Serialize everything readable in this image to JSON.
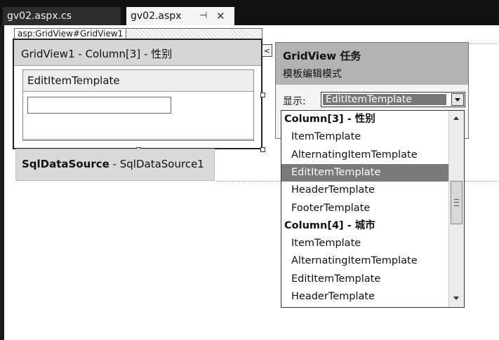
{
  "tabs": [
    {
      "label": "gv02.aspx.cs"
    },
    {
      "label": "gv02.aspx"
    }
  ],
  "icons": {
    "pin": "pin-icon",
    "close": "close-icon"
  },
  "designer": {
    "tag_label": "asp:GridView#GridView1",
    "column_title": "GridView1 - Column[3] - 性别",
    "template_header": "EditItemTemplate",
    "datasource_type": "SqlDataSource",
    "datasource_name": " - SqlDataSource1"
  },
  "smart_tag": {
    "toggle_glyph": "<",
    "title": "GridView 任务",
    "subtitle": "模板编辑模式",
    "display_label": "显示:",
    "selected_value": "EditItemTemplate"
  },
  "dropdown": {
    "items": [
      {
        "label": "Column[3] - 性别",
        "kind": "group"
      },
      {
        "label": "ItemTemplate",
        "kind": "item"
      },
      {
        "label": "AlternatingItemTemplate",
        "kind": "item"
      },
      {
        "label": "EditItemTemplate",
        "kind": "item",
        "selected": true
      },
      {
        "label": "HeaderTemplate",
        "kind": "item"
      },
      {
        "label": "FooterTemplate",
        "kind": "item"
      },
      {
        "label": "Column[4] - 城市",
        "kind": "group"
      },
      {
        "label": "ItemTemplate",
        "kind": "item"
      },
      {
        "label": "AlternatingItemTemplate",
        "kind": "item"
      },
      {
        "label": "EditItemTemplate",
        "kind": "item"
      },
      {
        "label": "HeaderTemplate",
        "kind": "item"
      }
    ]
  },
  "colors": {
    "selected_row": "#7a7a7a",
    "panel_header": "#b3b3b3",
    "tab_strip": "#111111"
  }
}
